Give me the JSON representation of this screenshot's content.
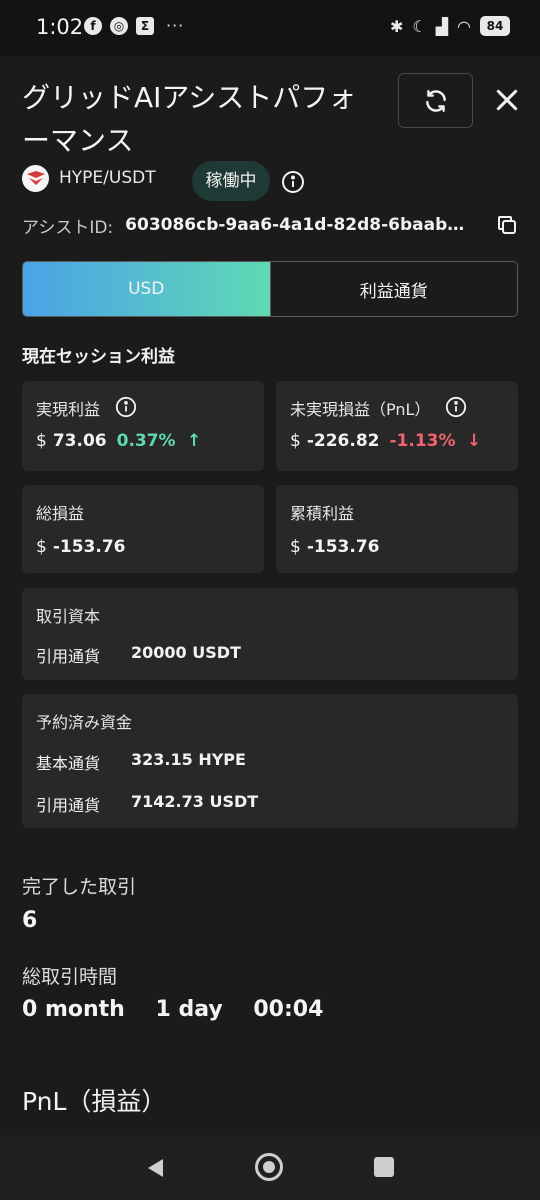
{
  "status_bar": {
    "time": "1:02",
    "notif_icons": [
      "facebook-icon",
      "chrome-icon",
      "app-icon"
    ],
    "more": "···",
    "battery": "84"
  },
  "header": {
    "title": "グリッドAIアシストパフォーマンス"
  },
  "pair": {
    "label": "HYPE/USDT",
    "status": "稼働中"
  },
  "assist": {
    "label": "アシストID:",
    "value": "603086cb-9aa6-4a1d-82d8-6baab1..."
  },
  "currency_toggle": {
    "options": [
      "USD",
      "利益通貨"
    ],
    "selected": "USD"
  },
  "session": {
    "title": "現在セッション利益",
    "realized": {
      "label": "実現利益",
      "currency": "$",
      "value": "73.06",
      "pct": "0.37%",
      "arrow": "↑"
    },
    "unrealized": {
      "label": "未実現損益（PnL）",
      "currency": "$",
      "value": "-226.82",
      "pct": "-1.13%",
      "arrow": "↓"
    },
    "total": {
      "label": "総損益",
      "currency": "$",
      "value": "-153.76"
    },
    "cumulative": {
      "label": "累積利益",
      "currency": "$",
      "value": "-153.76"
    },
    "capital": {
      "label": "取引資本",
      "rows": [
        {
          "k": "引用通貨",
          "v": "20000 USDT"
        }
      ]
    },
    "reserved": {
      "label": "予約済み資金",
      "rows": [
        {
          "k": "基本通貨",
          "v": "323.15 HYPE"
        },
        {
          "k": "引用通貨",
          "v": "7142.73 USDT"
        }
      ]
    }
  },
  "stats": {
    "completed_label": "完了した取引",
    "completed_value": "6",
    "duration_label": "総取引時間",
    "duration_value": "0 month    1 day    00:04"
  },
  "pnl_title": "PnL（損益）",
  "colors": {
    "background": "#1b1b1b",
    "card": "#282828",
    "positive": "#5fd9b3",
    "negative": "#f0646d",
    "toggle_gradient_start": "#4aa3e8",
    "toggle_gradient_end": "#5fd9b3",
    "badge": "#1f3a35"
  }
}
